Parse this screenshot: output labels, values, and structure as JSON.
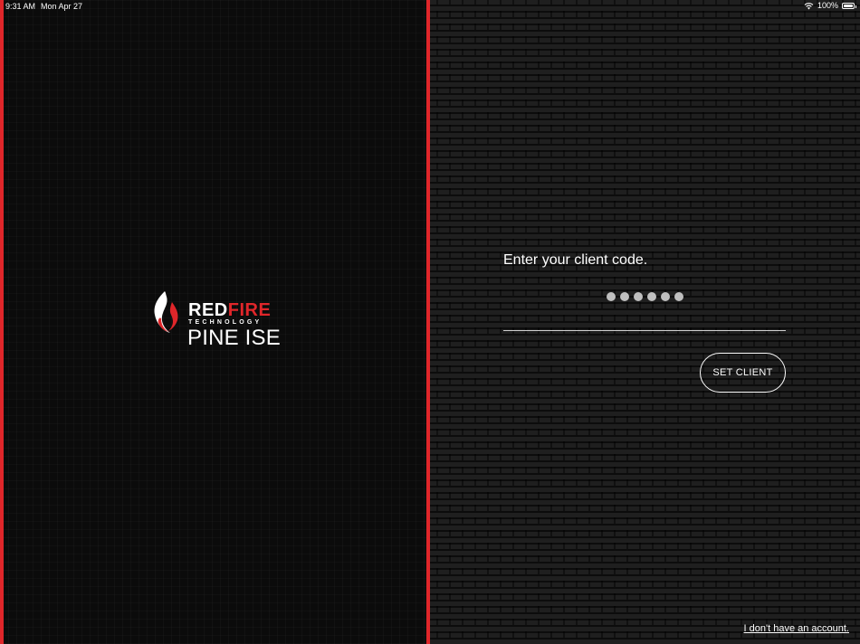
{
  "status_bar": {
    "time": "9:31 AM",
    "date": "Mon Apr 27",
    "battery": "100%",
    "wifi_icon": "wifi-icon",
    "battery_icon": "battery-icon"
  },
  "branding": {
    "brand_first": "RED",
    "brand_second": "FIRE",
    "sub": "TECHNOLOGY",
    "product": "PINE ISE",
    "logo_icon": "flame-icon"
  },
  "colors": {
    "accent": "#e0262a",
    "text": "#ffffff",
    "background": "#000000"
  },
  "form": {
    "prompt": "Enter your client code.",
    "code_masked_length": 6,
    "submit_label": "SET CLIENT",
    "no_account_link": "I don't have an account."
  }
}
